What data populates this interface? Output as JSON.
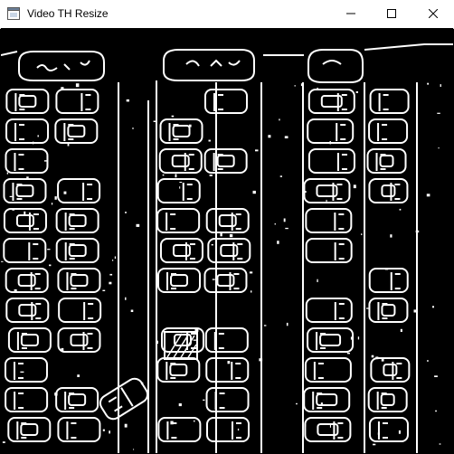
{
  "window": {
    "title": "Video TH Resize",
    "icon": "app-window-icon"
  },
  "controls": {
    "minimize_icon": "minimize-icon",
    "maximize_icon": "maximize-icon",
    "close_icon": "close-icon"
  },
  "video_frame": {
    "description_icon": "thresholded-parking-lot-frame",
    "colors": {
      "background": "#000000",
      "foreground": "#ffffff"
    }
  }
}
